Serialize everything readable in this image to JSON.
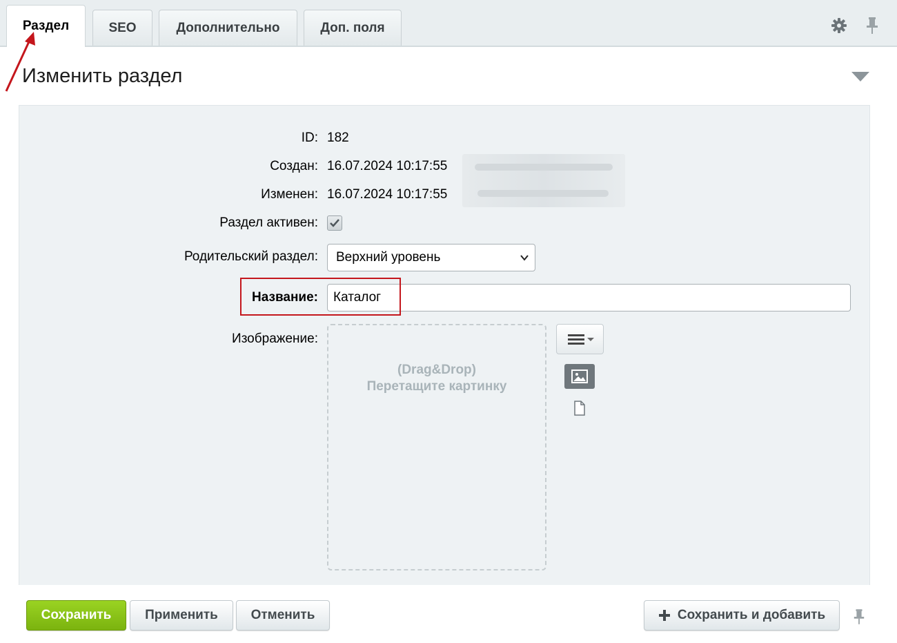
{
  "tabs": [
    {
      "label": "Раздел",
      "active": true
    },
    {
      "label": "SEO",
      "active": false
    },
    {
      "label": "Дополнительно",
      "active": false
    },
    {
      "label": "Доп. поля",
      "active": false
    }
  ],
  "icons": {
    "settings": "gear-icon",
    "pin": "pin-icon",
    "collapse": "triangle-down-icon",
    "menu": "hamburger-icon",
    "image": "image-icon",
    "file": "file-icon",
    "plus": "plus-icon"
  },
  "panel": {
    "title": "Изменить раздел"
  },
  "form": {
    "id_label": "ID:",
    "id_value": "182",
    "created_label": "Создан:",
    "created_value": "16.07.2024 10:17:55",
    "modified_label": "Изменен:",
    "modified_value": "16.07.2024 10:17:55",
    "active_label": "Раздел активен:",
    "active_checked": true,
    "parent_label": "Родительский раздел:",
    "parent_value": "Верхний уровень",
    "name_label": "Название:",
    "name_value": "Каталог",
    "image_label": "Изображение:",
    "dropzone_line1": "(Drag&Drop)",
    "dropzone_line2": "Перетащите картинку"
  },
  "footer": {
    "save": "Сохранить",
    "apply": "Применить",
    "cancel": "Отменить",
    "save_and_add": "Сохранить и добавить"
  },
  "colors": {
    "accent_green": "#86c21a",
    "annotation_red": "#c4161c",
    "form_background": "#eef2f4"
  }
}
